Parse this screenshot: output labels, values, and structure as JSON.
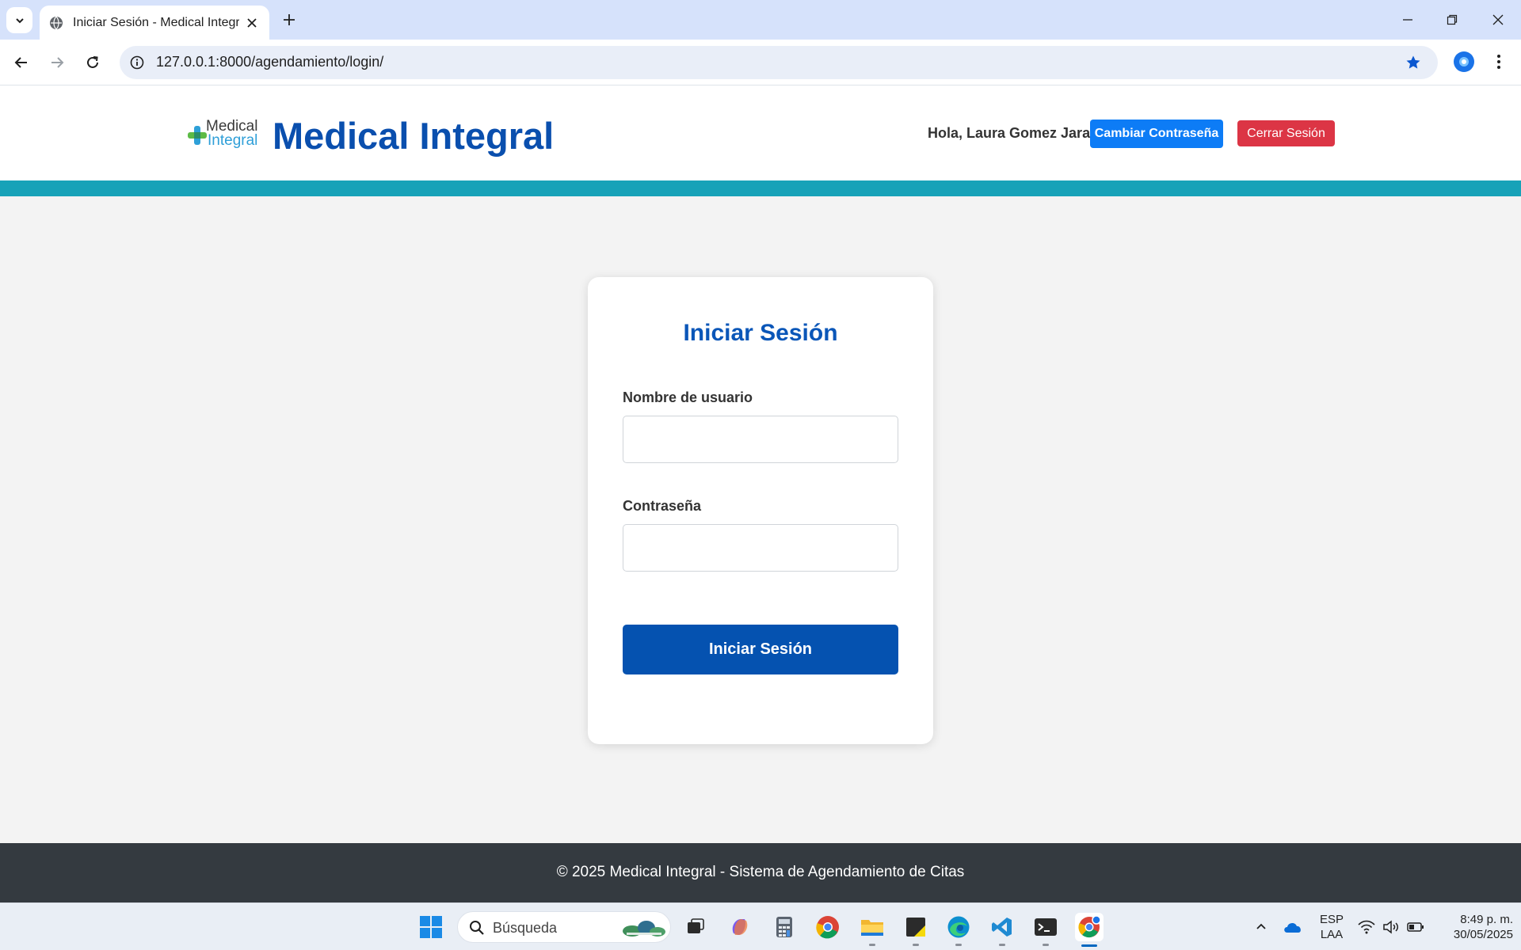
{
  "browser": {
    "tab_title": "Iniciar Sesión - Medical Integral",
    "url": "127.0.0.1:8000/agendamiento/login/"
  },
  "header": {
    "logo_line1": "Medical",
    "logo_line2": "Integral",
    "title": "Medical Integral",
    "greeting": "Hola, Laura Gomez Jara",
    "change_password": "Cambiar Contraseña",
    "logout": "Cerrar Sesión"
  },
  "login": {
    "title": "Iniciar Sesión",
    "username_label": "Nombre de usuario",
    "username_value": "",
    "password_label": "Contraseña",
    "password_value": "",
    "submit": "Iniciar Sesión"
  },
  "footer": {
    "text": "© 2025 Medical Integral - Sistema de Agendamiento de Citas"
  },
  "taskbar": {
    "search_placeholder": "Búsqueda",
    "language_line1": "ESP",
    "language_line2": "LAA",
    "time": "8:49 p. m.",
    "date": "30/05/2025"
  },
  "colors": {
    "brand": "#0a4fae",
    "accent_bar": "#17a2b8",
    "primary_button": "#0d7cf6",
    "danger_button": "#dc3545",
    "submit_button": "#0552b0",
    "footer_bg": "#343a40"
  },
  "icons": {
    "tab_search": "chevron-down-icon",
    "favicon": "globe-icon",
    "back": "arrow-left-icon",
    "forward": "arrow-right-icon",
    "reload": "reload-icon",
    "site_info": "info-icon",
    "bookmark": "star-icon"
  }
}
